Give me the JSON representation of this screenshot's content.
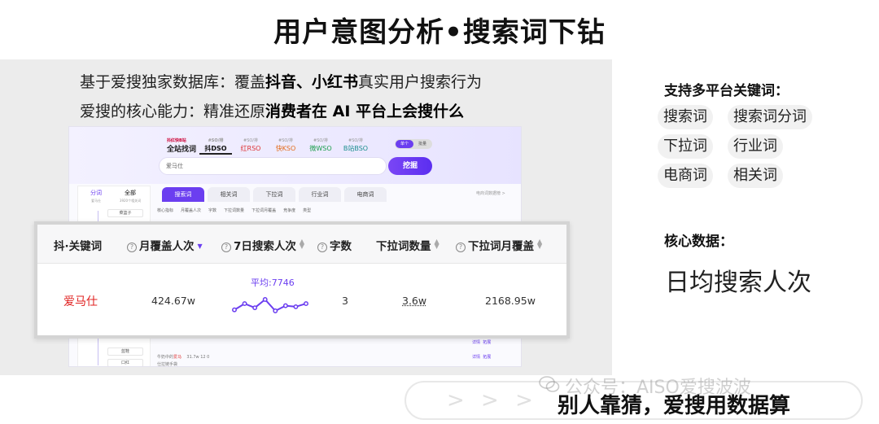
{
  "title": "用户意图分析•搜索词下钻",
  "intro": {
    "line1_prefix": "基于爱搜独家数据库：覆盖",
    "line1_bold": "抖音、小红书",
    "line1_suffix": "真实用户搜索行为",
    "line2_prefix": "爱搜的核心能力：精准还原",
    "line2_bold": "消费者在 AI 平台上会搜什么"
  },
  "app": {
    "brand_small": "抖红快B站",
    "brand": "全站找词",
    "platform_tabs": [
      {
        "small": "#SO/排",
        "label": "抖DSO",
        "active": true
      },
      {
        "small": "#SO/排",
        "label": "红RSO"
      },
      {
        "small": "#SO/排",
        "label": "快KSO"
      },
      {
        "small": "#SO/排",
        "label": "微WSO"
      },
      {
        "small": "#SO/排",
        "label": "B站BSO"
      }
    ],
    "toggle_on": "单个",
    "toggle_off": "批量",
    "search_value": "爱马仕",
    "dig_button": "挖掘",
    "side_tabs": [
      {
        "label": "分词",
        "small": "爱马仕",
        "active": true
      },
      {
        "label": "全部",
        "small": "3920个相关词"
      }
    ],
    "side_chips": [
      "菜篮子",
      "蓝鞋",
      "口红"
    ],
    "keyword_tabs": [
      "搜索词",
      "相关词",
      "下拉词",
      "行业词",
      "电商词"
    ],
    "notice": "电商词数据榜 >",
    "filters": [
      "核心指标",
      "月覆盖人次",
      "字数",
      "下拉词数量",
      "下拉词月覆盖",
      "竞争度",
      "类型"
    ],
    "bg_rows": [
      {
        "prefix": "牛奶中的",
        "red": "爱马",
        "values": "31.7w      12      0"
      },
      {
        "prefix": "仕拉链手袋",
        "red": "",
        "values": ""
      }
    ],
    "row_ops": [
      "详情",
      "拓展"
    ]
  },
  "table": {
    "headers": [
      {
        "label": "抖·关键词",
        "help": false,
        "sort": ""
      },
      {
        "label": "月覆盖人次",
        "help": true,
        "sort": "active"
      },
      {
        "label": "7日搜索人次",
        "help": true,
        "sort": "both"
      },
      {
        "label": "字数",
        "help": true,
        "sort": ""
      },
      {
        "label": "下拉词数量",
        "help": false,
        "sort": "both"
      },
      {
        "label": "下拉词月覆盖",
        "help": true,
        "sort": "both"
      }
    ],
    "row": {
      "keyword": "爱马仕",
      "monthly_reach": "424.67w",
      "avg_label": "平均:7746",
      "spark_values": [
        7700,
        7760,
        7720,
        7800,
        7690,
        7740,
        7730,
        7760
      ],
      "char_count": "3",
      "dropdown_count": "3.6w",
      "dropdown_monthly": "2168.95w"
    }
  },
  "right": {
    "platform_title": "支持多平台关键词：",
    "chips": [
      "搜索词",
      "搜索词分词",
      "下拉词",
      "行业词",
      "电商词",
      "相关词"
    ],
    "core_title": "核心数据：",
    "core_value": "日均搜索人次"
  },
  "banner": {
    "arrows": "> > >",
    "text": "别人靠猜，爱搜用数据算",
    "watermark": "公众号：AISO爱搜波波"
  },
  "colors": {
    "accent": "#6b3ef0",
    "keyword_red": "#e0201f"
  }
}
